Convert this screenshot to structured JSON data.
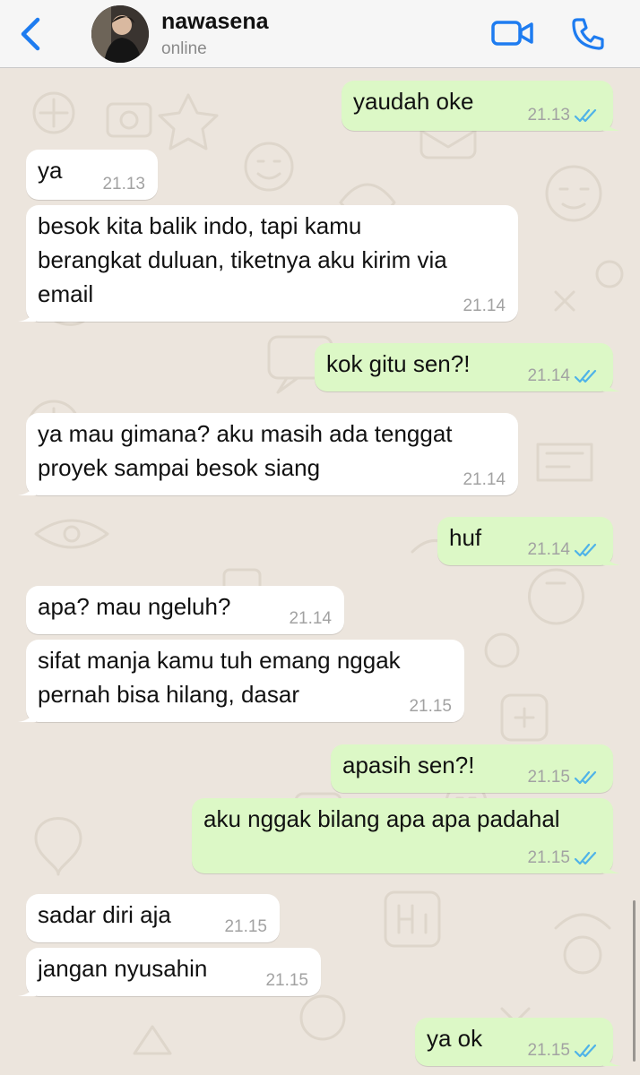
{
  "header": {
    "contact_name": "nawasena",
    "contact_status": "online",
    "icons": [
      "back-chevron-icon",
      "video-call-icon",
      "voice-call-icon"
    ],
    "accent_color": "#1E7CF0"
  },
  "colors": {
    "background": "#ECE5DD",
    "incoming": "#FFFFFF",
    "outgoing": "#DCF8C6",
    "read_ticks": "#4FB3E8"
  },
  "messages": [
    {
      "dir": "out",
      "text": "yaudah oke",
      "time": "21.13"
    },
    {
      "dir": "in",
      "text": "ya",
      "time": "21.13"
    },
    {
      "dir": "in",
      "text": "besok kita balik indo, tapi kamu\nberangkat duluan, tiketnya aku kirim via\nemail",
      "time": "21.14"
    },
    {
      "dir": "out",
      "text": "kok gitu sen?!",
      "time": "21.14"
    },
    {
      "dir": "in",
      "text": "ya mau gimana? aku masih ada tenggat\nproyek sampai besok siang",
      "time": "21.14"
    },
    {
      "dir": "out",
      "text": "huf",
      "time": "21.14"
    },
    {
      "dir": "in",
      "text": "apa? mau ngeluh?",
      "time": "21.14"
    },
    {
      "dir": "in",
      "text": "sifat manja kamu tuh emang nggak\npernah bisa hilang, dasar",
      "time": "21.15"
    },
    {
      "dir": "out",
      "text": "apasih sen?!",
      "time": "21.15"
    },
    {
      "dir": "out",
      "text": "aku nggak bilang apa apa padahal",
      "time": "21.15"
    },
    {
      "dir": "in",
      "text": "sadar diri aja",
      "time": "21.15"
    },
    {
      "dir": "in",
      "text": "jangan nyusahin",
      "time": "21.15"
    },
    {
      "dir": "out",
      "text": "ya ok",
      "time": "21.15"
    }
  ]
}
